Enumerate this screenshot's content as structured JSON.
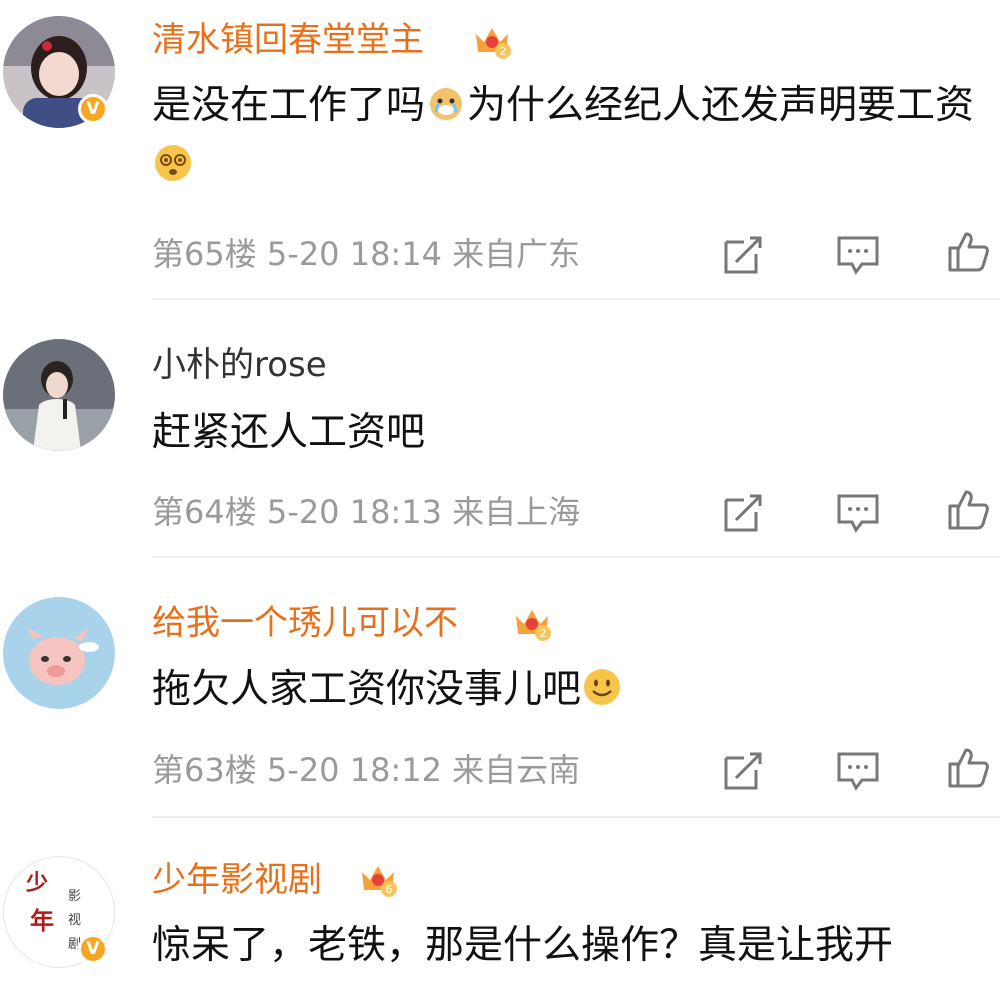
{
  "comments": [
    {
      "username": "清水镇回春堂堂主",
      "text_parts": [
        "是没在工作了吗",
        "为什么经纪人还发声明要工资",
        ""
      ],
      "floor": "第65楼",
      "time": "5-20 18:14",
      "location": "来自广东",
      "vip_level": "2",
      "verified": true
    },
    {
      "username": "小朴的rose",
      "text_parts": [
        "赶紧还人工资吧"
      ],
      "floor": "第64楼",
      "time": "5-20 18:13",
      "location": "来自上海",
      "verified": false
    },
    {
      "username": "给我一个琇儿可以不",
      "text_parts": [
        "拖欠人家工资你没事儿吧",
        ""
      ],
      "floor": "第63楼",
      "time": "5-20 18:12",
      "location": "来自云南",
      "vip_level": "2",
      "verified": false
    },
    {
      "username": "少年影视剧",
      "text_parts": [
        "惊呆了，老铁，那是什么操作？真是让我开"
      ],
      "vip_level": "6",
      "verified": true,
      "avatar_text": [
        "少",
        "年",
        "影",
        "视",
        "剧"
      ]
    }
  ],
  "colors": {
    "vip_name": "#e8701a",
    "meta": "#9a9a9a",
    "verified": "#f5a623"
  }
}
